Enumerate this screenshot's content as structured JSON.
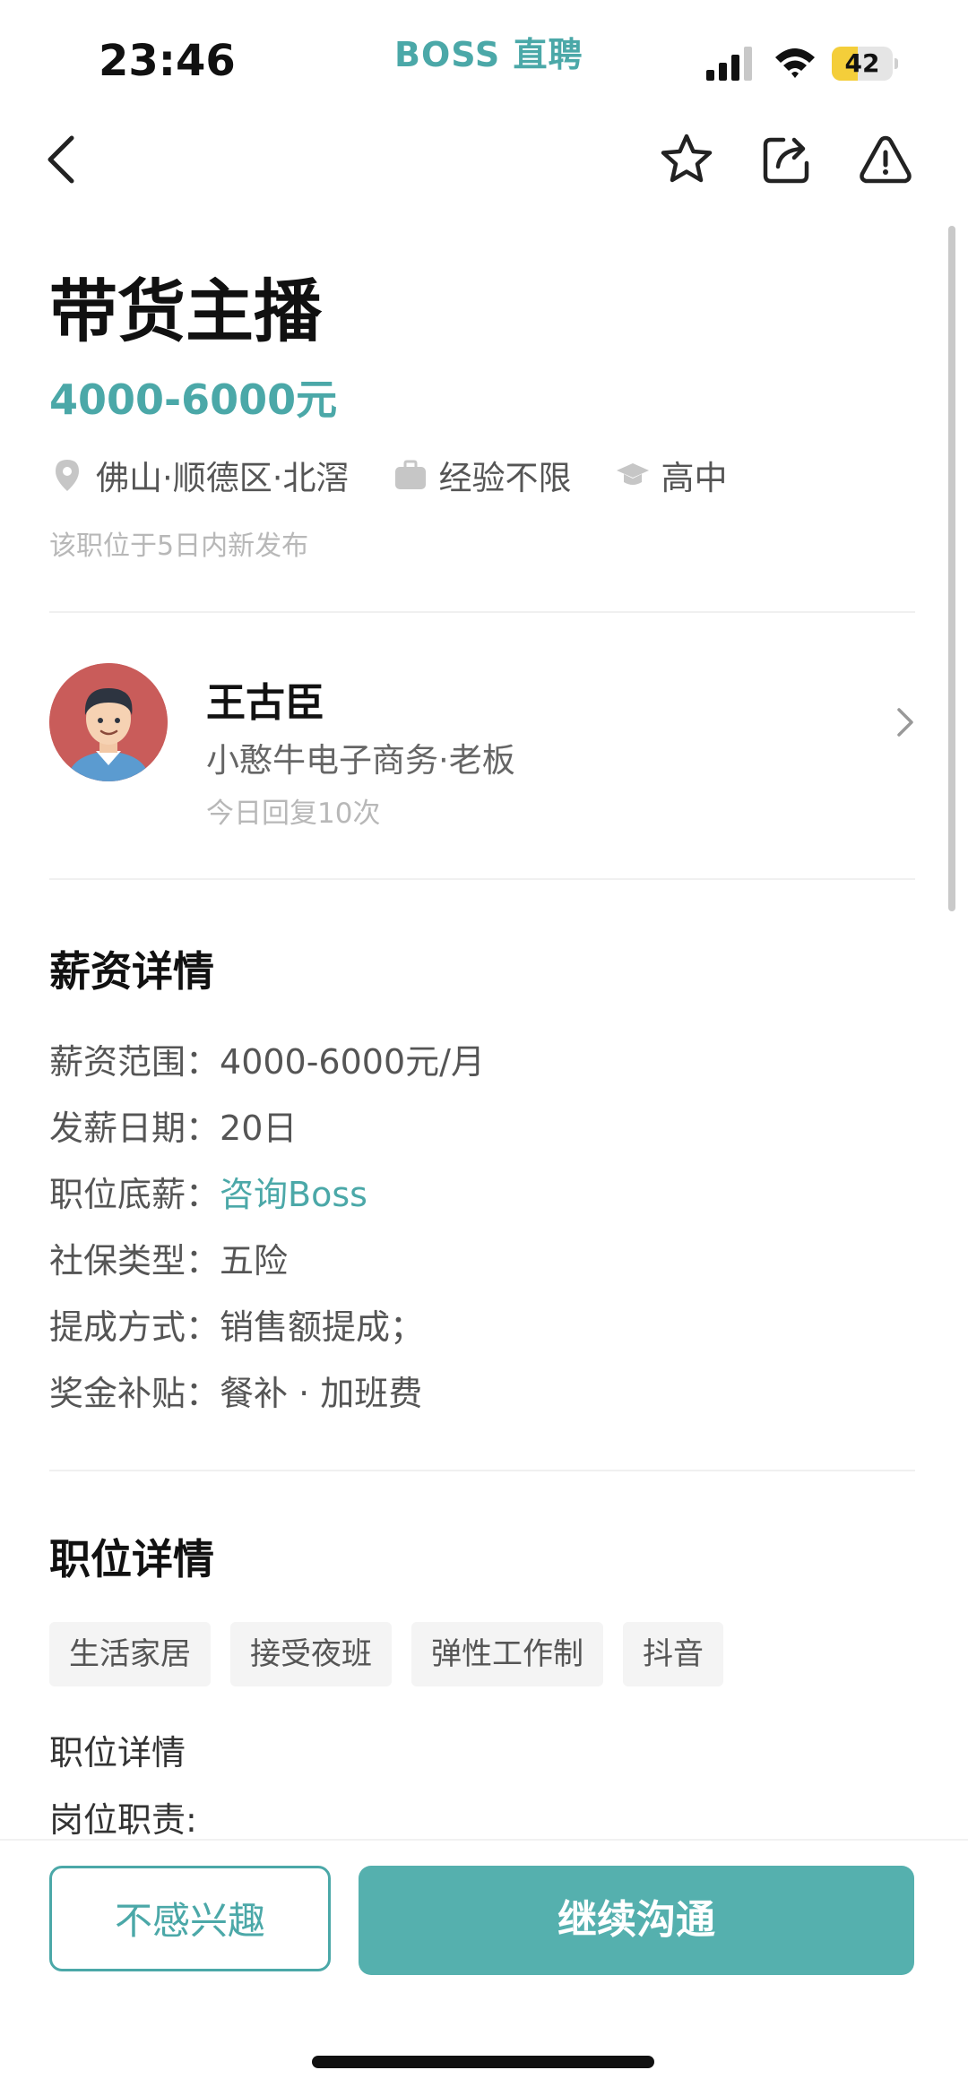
{
  "status_bar": {
    "time": "23:46",
    "app_name": "BOSS 直聘",
    "battery": "42",
    "battery_level": 0.42
  },
  "nav": {
    "icons": [
      "back-arrow-icon",
      "star-icon",
      "share-icon",
      "warning-icon"
    ]
  },
  "job": {
    "title": "带货主播",
    "salary": "4000-6000元",
    "location": "佛山·顺德区·北滘",
    "experience": "经验不限",
    "education": "高中",
    "posted": "该职位于5日内新发布"
  },
  "recruiter": {
    "name": "王古臣",
    "company_role": "小憨牛电子商务·老板",
    "reply_stats": "今日回复10次"
  },
  "salary_section": {
    "title": "薪资详情",
    "items": [
      {
        "label": "薪资范围：",
        "value": "4000-6000元/月"
      },
      {
        "label": "发薪日期：",
        "value": "20日"
      },
      {
        "label": "职位底薪：",
        "value": "咨询Boss"
      },
      {
        "label": "社保类型：",
        "value": "五险"
      },
      {
        "label": "提成方式：",
        "value": "销售额提成；"
      },
      {
        "label": "奖金补贴：",
        "value": "餐补 · 加班费"
      }
    ]
  },
  "job_section": {
    "title": "职位详情",
    "tags": [
      "生活家居",
      "接受夜班",
      "弹性工作制",
      "抖音"
    ],
    "detail_label": "职位详情",
    "responsibilities_label": "岗位职责:"
  },
  "actions": {
    "not_interested": "不感兴趣",
    "continue_chat": "继续沟通"
  },
  "colors": {
    "accent": "#4ba8a8",
    "button": "#55b0ae",
    "battery": "#f4ce3a"
  }
}
